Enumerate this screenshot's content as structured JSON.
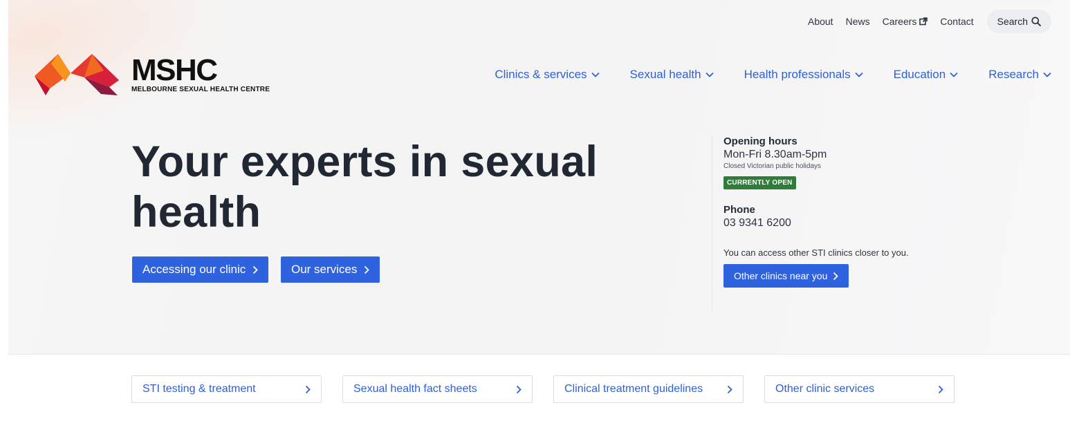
{
  "brand": {
    "name": "MSHC",
    "subtitle": "MELBOURNE SEXUAL HEALTH CENTRE",
    "logo_colors": [
      "#e8452c",
      "#f39a1d",
      "#c8102e",
      "#7b1d3a"
    ]
  },
  "utility_nav": {
    "items": [
      {
        "label": "About"
      },
      {
        "label": "News"
      },
      {
        "label": "Careers",
        "icon": "external-link-icon"
      },
      {
        "label": "Contact"
      }
    ],
    "search_label": "Search"
  },
  "main_nav": {
    "items": [
      {
        "label": "Clinics & services"
      },
      {
        "label": "Sexual health"
      },
      {
        "label": "Health professionals"
      },
      {
        "label": "Education"
      },
      {
        "label": "Research"
      }
    ]
  },
  "hero": {
    "title": "Your experts in sexual health",
    "buttons": [
      {
        "label": "Accessing our clinic"
      },
      {
        "label": "Our services"
      }
    ]
  },
  "info": {
    "hours_label": "Opening hours",
    "hours_value": "Mon-Fri 8.30am-5pm",
    "hours_note": "Closed Victorian public holidays",
    "status": "CURRENTLY OPEN",
    "phone_label": "Phone",
    "phone_value": "03 9341 6200",
    "other_note": "You can access other STI clinics closer to you.",
    "other_button": "Other clinics near you"
  },
  "quick_links": [
    {
      "label": "STI testing & treatment"
    },
    {
      "label": "Sexual health fact sheets"
    },
    {
      "label": "Clinical treatment guidelines"
    },
    {
      "label": "Other clinic services"
    }
  ],
  "colors": {
    "accent": "#2e62de",
    "link": "#2f5fd6",
    "status_open": "#2e7d38",
    "heading": "#212833"
  }
}
